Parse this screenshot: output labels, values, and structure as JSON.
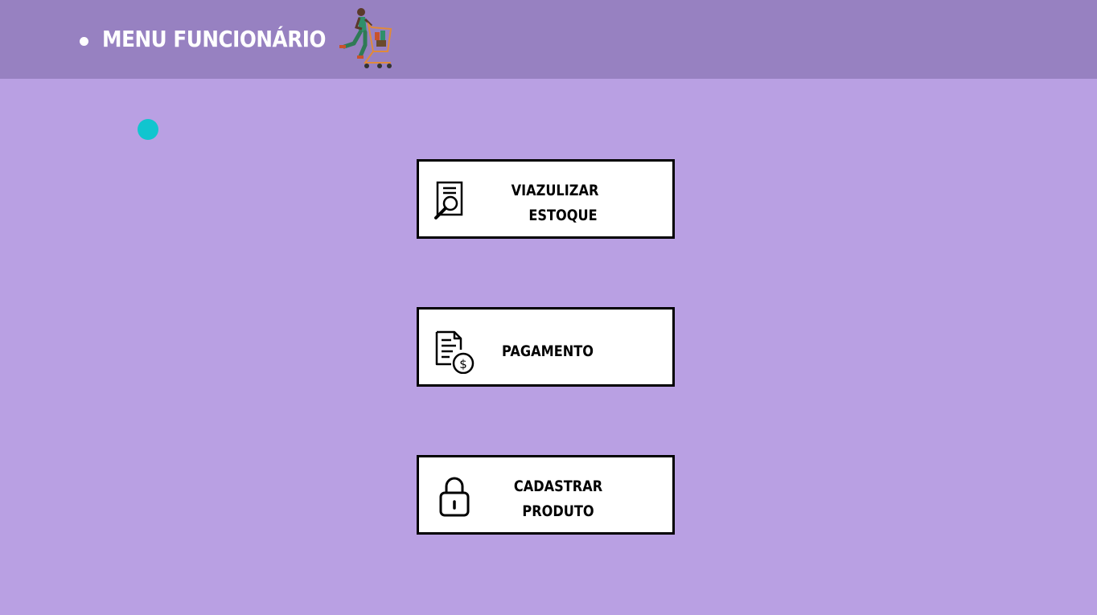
{
  "header": {
    "title": "MENU FUNCIONÁRIO",
    "mascot_icon": "shopping-cart-person-icon",
    "background": "#9781c1"
  },
  "page": {
    "background": "#b9a0e3",
    "accent_dot_color": "#11c5cf"
  },
  "menu": {
    "estoque": {
      "line1": "VIAZULIZAR",
      "line2": "ESTOQUE",
      "icon": "search-document-icon"
    },
    "pagamento": {
      "line1": "PAGAMENTO",
      "icon": "invoice-dollar-icon"
    },
    "cadastrar": {
      "line1": "CADASTRAR",
      "line2": "PRODUTO",
      "icon": "lock-icon"
    }
  }
}
